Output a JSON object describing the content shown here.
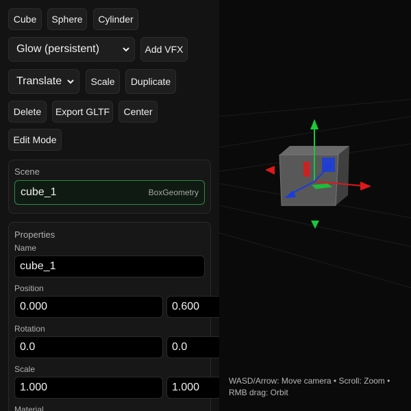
{
  "toolbar": {
    "cube": "Cube",
    "sphere": "Sphere",
    "cylinder": "Cylinder",
    "vfx_select": "Glow (persistent)",
    "add_vfx": "Add VFX",
    "mode_select": "Translate",
    "scale": "Scale",
    "duplicate": "Duplicate",
    "delete": "Delete",
    "export_gltf": "Export GLTF",
    "center": "Center",
    "edit_mode": "Edit Mode"
  },
  "scene": {
    "title": "Scene",
    "items": [
      {
        "name": "cube_1",
        "type": "BoxGeometry"
      }
    ]
  },
  "properties": {
    "title": "Properties",
    "name_label": "Name",
    "name_value": "cube_1",
    "position_label": "Position",
    "position": [
      "0.000",
      "0.600"
    ],
    "rotation_label": "Rotation",
    "rotation": [
      "0.0",
      "0.0"
    ],
    "scale_label": "Scale",
    "scale": [
      "1.000",
      "1.000"
    ],
    "material_label": "Material"
  },
  "viewport": {
    "help_text": "WASD/Arrow: Move camera • Scroll: Zoom • RMB drag: Orbit"
  },
  "colors": {
    "gizmo_x": "#e01818",
    "gizmo_y": "#18c83a",
    "gizmo_z": "#1a3cdc",
    "selection_accent": "#2f8a45"
  },
  "icons": {
    "dropdown": "chevron-down-icon"
  }
}
